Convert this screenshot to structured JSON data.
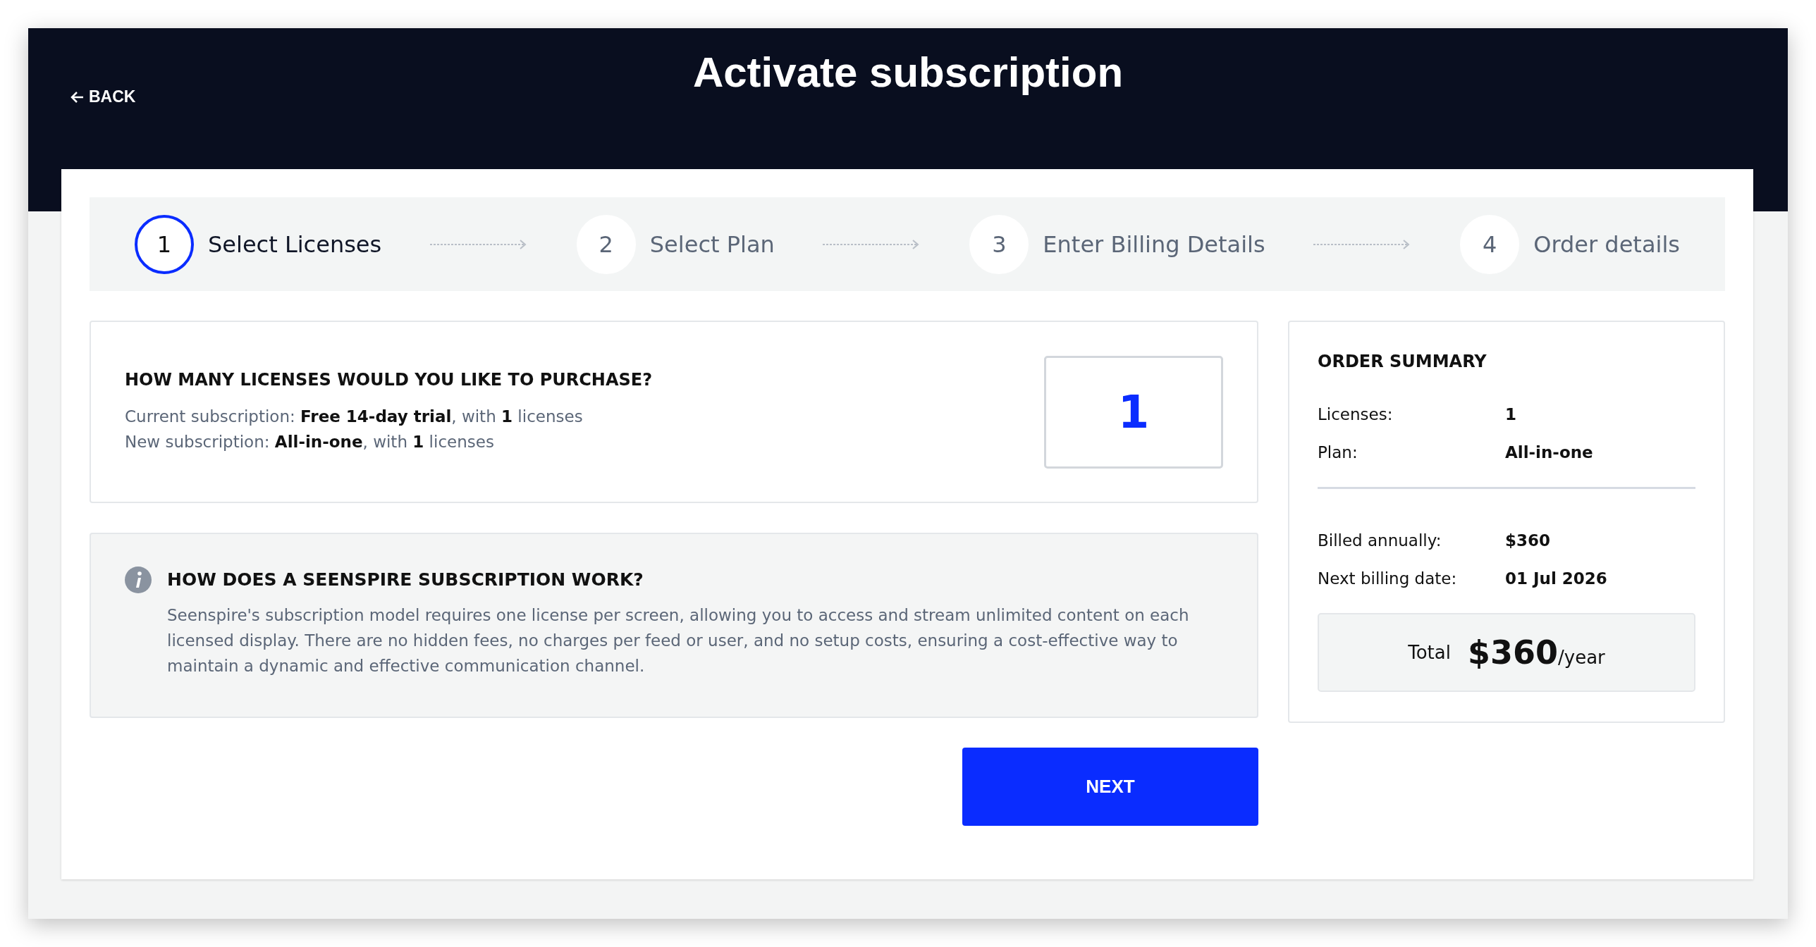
{
  "header": {
    "back": "BACK",
    "title": "Activate subscription"
  },
  "steps": [
    {
      "number": "1",
      "label": "Select Licenses",
      "selected": true
    },
    {
      "number": "2",
      "label": "Select Plan",
      "selected": false
    },
    {
      "number": "3",
      "label": "Enter Billing Details",
      "selected": false
    },
    {
      "number": "4",
      "label": "Order details",
      "selected": false
    }
  ],
  "licenses": {
    "question": "HOW MANY LICENSES WOULD YOU LIKE TO PURCHASE?",
    "lines": [
      "Current subscription: **Free 14-day trial**, with **1** licenses",
      "New subscription: **All-in-one**, with **1** licenses"
    ],
    "value": "1"
  },
  "info": {
    "title": "HOW DOES A SEENSPIRE SUBSCRIPTION WORK?",
    "text": "Seenspire's subscription model requires one license per screen, allowing you to access and stream unlimited content on each licensed display. There are no hidden fees, no charges per feed or user, and no setup costs, ensuring a cost-effective way to maintain a dynamic and effective communication channel."
  },
  "next_button": "NEXT",
  "summary": {
    "title": "ORDER SUMMARY",
    "groups": [
      [
        {
          "label": "Licenses:",
          "value": "1"
        },
        {
          "label": "Plan:",
          "value": "All-in-one"
        }
      ],
      [
        {
          "label": "Billed annually:",
          "value": "$360"
        },
        {
          "label": "Next billing date:",
          "value": "01 Jul 2026"
        }
      ]
    ],
    "total_label": "Total",
    "total_amount": "$360",
    "total_period": "/year"
  }
}
